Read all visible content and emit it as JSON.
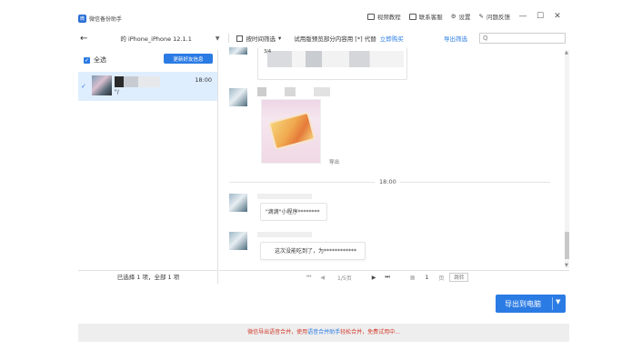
{
  "app": {
    "title": "微信备份助手"
  },
  "titlebar": {
    "video_tutorial": "视频教程",
    "contact_support": "联系客服",
    "settings": "设置",
    "feedback": "问题反馈"
  },
  "toolbar": {
    "device": "的 iPhone_iPhone 12.1.1",
    "time_filter": "按时间筛选",
    "trial_text": "试用版预览部分内容用 [*] 代替",
    "buy_now": "立即购买",
    "export_filter": "导出筛选",
    "search_placeholder": "Q"
  },
  "left": {
    "select_all": "全选",
    "update_friends": "更新好友信息",
    "contact": {
      "sub": "\"/",
      "time": "18:00"
    },
    "footer": "已选择 1 项，全部 1 项"
  },
  "chat": {
    "msg1_text": "3/4        ",
    "image_label": "导出",
    "time_divider": "18:00",
    "msg2_text": "\"滴滴\"小程序********",
    "msg3_text": "这次没能吃到了，为************"
  },
  "pager": {
    "page_info": "1/5页",
    "page_input": "1",
    "page_unit": "页",
    "go": "跳转"
  },
  "export": {
    "label": "导出到电脑"
  },
  "banner": {
    "prefix": "微信导出语音合并，使用",
    "link": "语音合并助手",
    "suffix": "轻松合并，免费试用中..."
  },
  "colors": {
    "accent": "#2b7be4",
    "selected_row": "#dfeefe",
    "banner_text": "#d03a2b"
  }
}
